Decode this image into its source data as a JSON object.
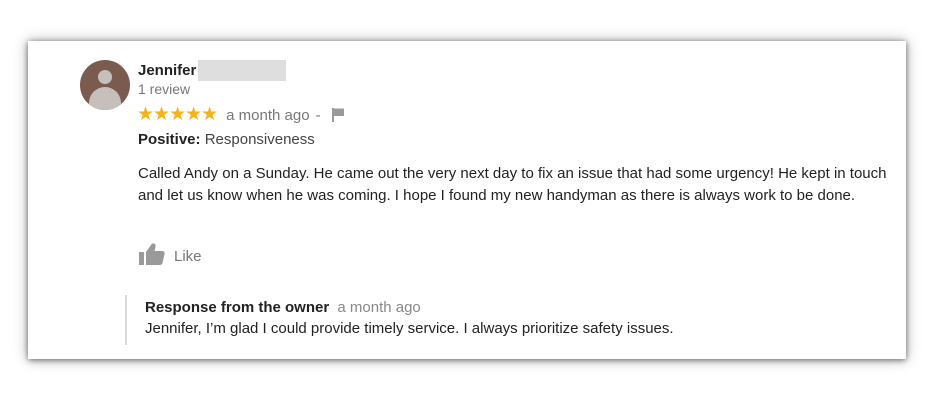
{
  "review": {
    "author_name": "Jennifer",
    "review_count": "1 review",
    "stars": "★★★★★",
    "rating": 5,
    "time": "a month ago",
    "separator": "-",
    "positive_label": "Positive:",
    "positive_value": "Responsiveness",
    "text": "Called Andy on a Sunday. He came out the very next day to fix an issue that had some urgency! He kept in touch and let us know when he was coming. I hope I found my new handyman as there is always work to be done.",
    "like_label": "Like"
  },
  "owner_response": {
    "title": "Response from the owner",
    "time": "a month ago",
    "text": "Jennifer, I’m glad I could provide timely service. I always prioritize safety issues."
  },
  "icons": {
    "avatar": "person-avatar",
    "flag": "flag-icon",
    "like": "thumbs-up-icon"
  },
  "colors": {
    "star": "#f2b320",
    "avatar_bg": "#7b5b4e",
    "muted_text": "#777777"
  }
}
